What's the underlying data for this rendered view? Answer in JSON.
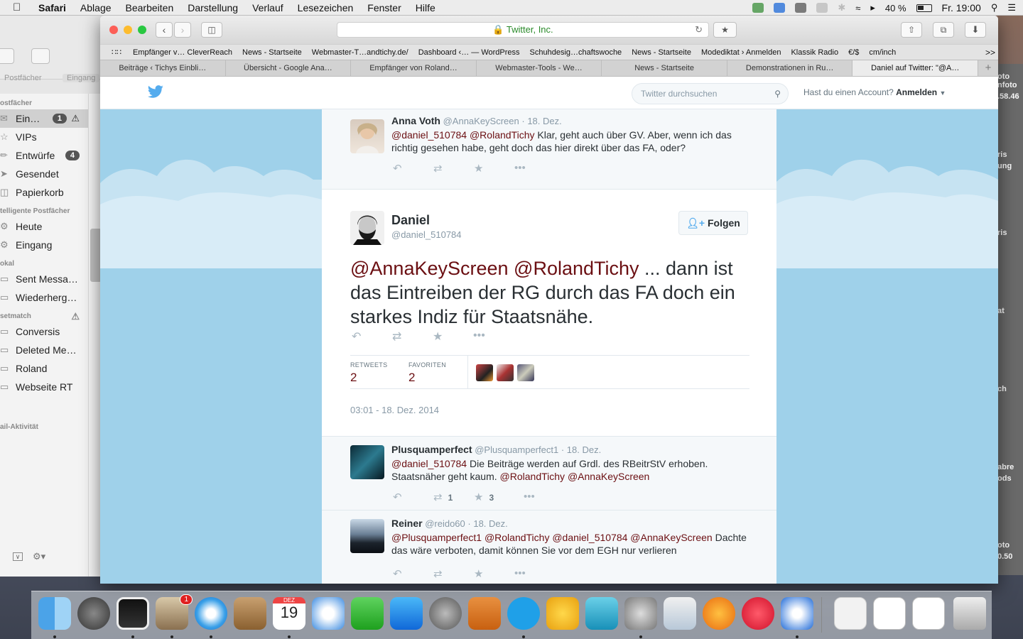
{
  "menubar": {
    "app": "Safari",
    "items": [
      "Ablage",
      "Bearbeiten",
      "Darstellung",
      "Verlauf",
      "Lesezeichen",
      "Fenster",
      "Hilfe"
    ],
    "battery": "40 %",
    "clock": "Fr. 19:00"
  },
  "mail": {
    "filter_labels": [
      "Postfächer",
      "Eingang"
    ],
    "sections": [
      {
        "header": "ostfächer",
        "items": [
          {
            "label": "Ein…",
            "badge": "1",
            "icon": "inbox-icon",
            "warn": true,
            "selected": true
          },
          {
            "label": "VIPs",
            "icon": "star-icon"
          },
          {
            "label": "Entwürfe",
            "badge": "4",
            "icon": "draft-icon"
          },
          {
            "label": "Gesendet",
            "icon": "paperplane-icon"
          },
          {
            "label": "Papierkorb",
            "icon": "trash-icon"
          }
        ]
      },
      {
        "header": "telligente Postfächer",
        "items": [
          {
            "label": "Heute",
            "icon": "gear-icon"
          },
          {
            "label": "Eingang",
            "icon": "gear-icon"
          }
        ]
      },
      {
        "header": "okal",
        "items": [
          {
            "label": "Sent Messa…",
            "icon": "folder-icon"
          },
          {
            "label": "Wiederherg…",
            "icon": "folder-icon"
          }
        ]
      },
      {
        "header": "setmatch",
        "warn": true,
        "items": [
          {
            "label": "Conversis",
            "icon": "folder-icon"
          },
          {
            "label": "Deleted Me…",
            "icon": "folder-icon"
          },
          {
            "label": "Roland",
            "icon": "folder-icon"
          },
          {
            "label": "Webseite RT",
            "icon": "folder-icon"
          }
        ]
      },
      {
        "header": "ail-Aktivität",
        "items": []
      }
    ]
  },
  "right_window_fragments": [
    "oto",
    "nfoto",
    ".58.46",
    "ris",
    "ung",
    "ris",
    "at",
    "ch",
    "abre",
    "ods",
    "oto",
    "0.50"
  ],
  "safari": {
    "url_label": "Twitter, Inc.",
    "bookmarks": [
      "Empfänger v… CleverReach",
      "News - Startseite",
      "Webmaster-T…andtichy.de/",
      "Dashboard ‹… — WordPress",
      "Schuhdesig…chaftswoche",
      "News - Startseite",
      "Modediktat › Anmelden",
      "Klassik Radio",
      "€/$",
      "cm/inch"
    ],
    "bookmarks_more": ">>",
    "tabs": [
      "Beiträge ‹ Tichys Einbli…",
      "Übersicht - Google Ana…",
      "Empfänger von Roland…",
      "Webmaster-Tools - We…",
      "News - Startseite",
      "Demonstrationen in Ru…",
      "Daniel auf Twitter: \"@A…"
    ],
    "active_tab": 6,
    "new_tab": "+"
  },
  "twitter": {
    "search_placeholder": "Twitter durchsuchen",
    "account_prompt": "Hast du einen Account?",
    "login_label": "Anmelden",
    "tweets": [
      {
        "name": "Anna Voth",
        "handle": "@AnnaKeyScreen",
        "date": "· 18. Dez.",
        "mentions": "@daniel_510784 @RolandTichy",
        "text": " Klar, geht auch über GV. Aber, wenn ich das richtig gesehen habe, geht doch das hier direkt über das FA, oder?"
      },
      {
        "name": "Plusquamperfect",
        "handle": "@Plusquamperfect1",
        "date": "· 18. Dez.",
        "mentions": "@daniel_510784",
        "text": " Die Beiträge werden auf Grdl. des RBeitrStV erhoben. Staatsnäher geht kaum. ",
        "mentions2": "@RolandTichy @AnnaKeyScreen",
        "retweets": "1",
        "favorites": "3"
      },
      {
        "name": "Reiner",
        "handle": "@reido60",
        "date": "· 18. Dez.",
        "mentions": "@Plusquamperfect1 @RolandTichy @daniel_510784 @AnnaKeyScreen",
        "text": " Dachte das wäre verboten, damit können Sie vor dem EGH nur verlieren"
      }
    ],
    "main": {
      "name": "Daniel",
      "handle": "@daniel_510784",
      "follow_label": "Folgen",
      "mentions": "@AnnaKeyScreen @RolandTichy",
      "text": " ... dann ist das Eintreiben der RG durch das FA doch ein starkes Indiz für Staatsnähe.",
      "retweets_label": "RETWEETS",
      "retweets": "2",
      "favorites_label": "FAVORITEN",
      "favorites": "2",
      "timestamp": "03:01 - 18. Dez. 2014"
    }
  },
  "dock": {
    "items": [
      "finder-icon",
      "launchpad-icon",
      "activity-icon",
      "mail-icon",
      "safari-icon",
      "contacts-icon",
      "calendar-icon",
      "tweetdeck-icon",
      "facetime-icon",
      "appstore-icon",
      "system-preferences-icon",
      "calculator-icon",
      "skype-icon",
      "wunderlist-icon",
      "migration-icon",
      "automator-icon",
      "preview-icon",
      "ibooks-icon",
      "itunes-icon",
      "teamviewer-icon",
      "document-icon",
      "document-icon",
      "document-icon",
      "trash-icon"
    ],
    "mail_badge": "1",
    "calendar_month": "DEZ",
    "calendar_day": "19"
  }
}
